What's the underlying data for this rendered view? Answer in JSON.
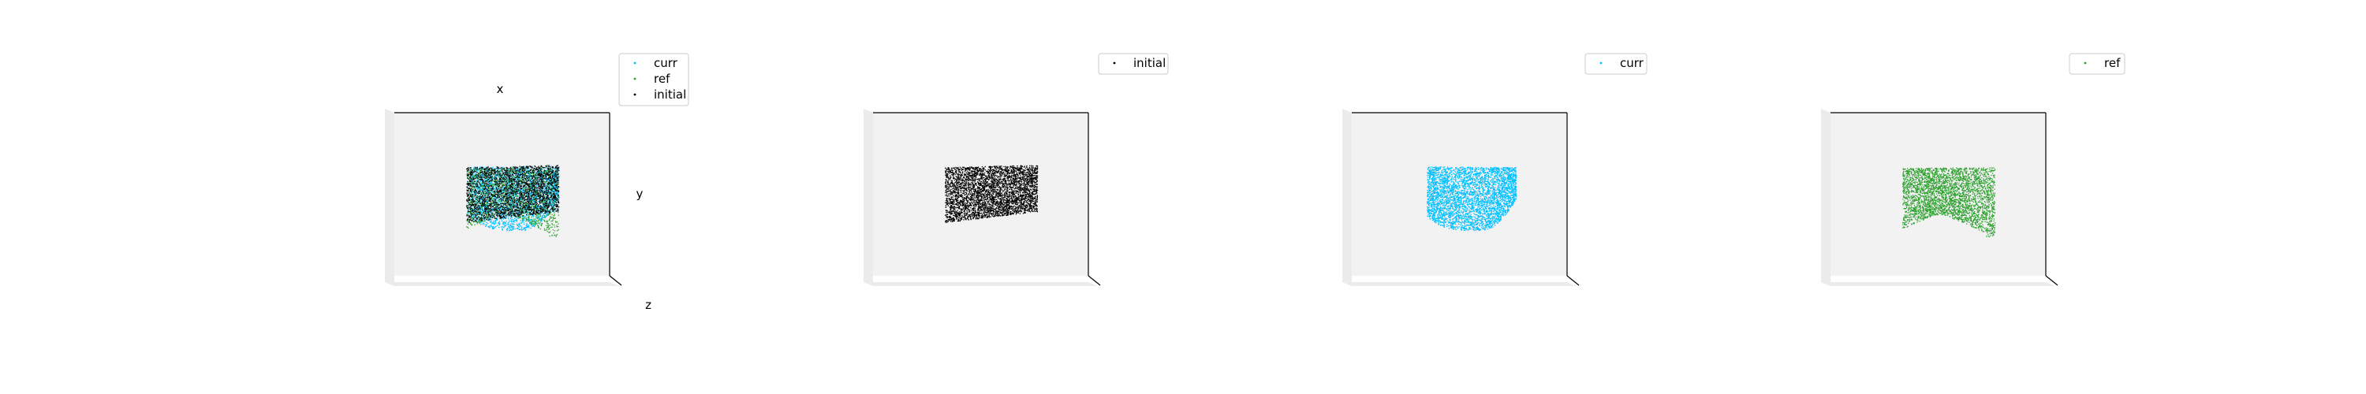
{
  "colors": {
    "curr": "#00bfff",
    "ref": "#2ca02c",
    "initial": "#000000",
    "pane_face": "#f2f2f3",
    "pane_side": "#ebebec",
    "axis_line": "#000000",
    "legend_border": "#cccccc"
  },
  "chart_data": [
    {
      "type": "scatter",
      "projection": "3d",
      "xlabel": "x",
      "ylabel": "y",
      "zlabel": "z",
      "grid": false,
      "legend_position": "upper-right",
      "legend": [
        "curr",
        "ref",
        "initial"
      ],
      "series": [
        {
          "name": "curr",
          "color_key": "curr",
          "shape": "rounded-bottom",
          "points": 2200
        },
        {
          "name": "ref",
          "color_key": "ref",
          "shape": "notched-bottom",
          "points": 1600
        },
        {
          "name": "initial",
          "color_key": "initial",
          "shape": "block",
          "points": 2600
        }
      ]
    },
    {
      "type": "scatter",
      "projection": "3d",
      "grid": false,
      "legend_position": "upper-right",
      "legend": [
        "initial"
      ],
      "series": [
        {
          "name": "initial",
          "color_key": "initial",
          "shape": "block",
          "points": 3800
        }
      ]
    },
    {
      "type": "scatter",
      "projection": "3d",
      "grid": false,
      "legend_position": "upper-right",
      "legend": [
        "curr"
      ],
      "series": [
        {
          "name": "curr",
          "color_key": "curr",
          "shape": "rounded-bottom",
          "points": 3800
        }
      ]
    },
    {
      "type": "scatter",
      "projection": "3d",
      "grid": false,
      "legend_position": "upper-right",
      "legend": [
        "ref"
      ],
      "series": [
        {
          "name": "ref",
          "color_key": "ref",
          "shape": "notched-bottom",
          "points": 3200
        }
      ]
    }
  ]
}
